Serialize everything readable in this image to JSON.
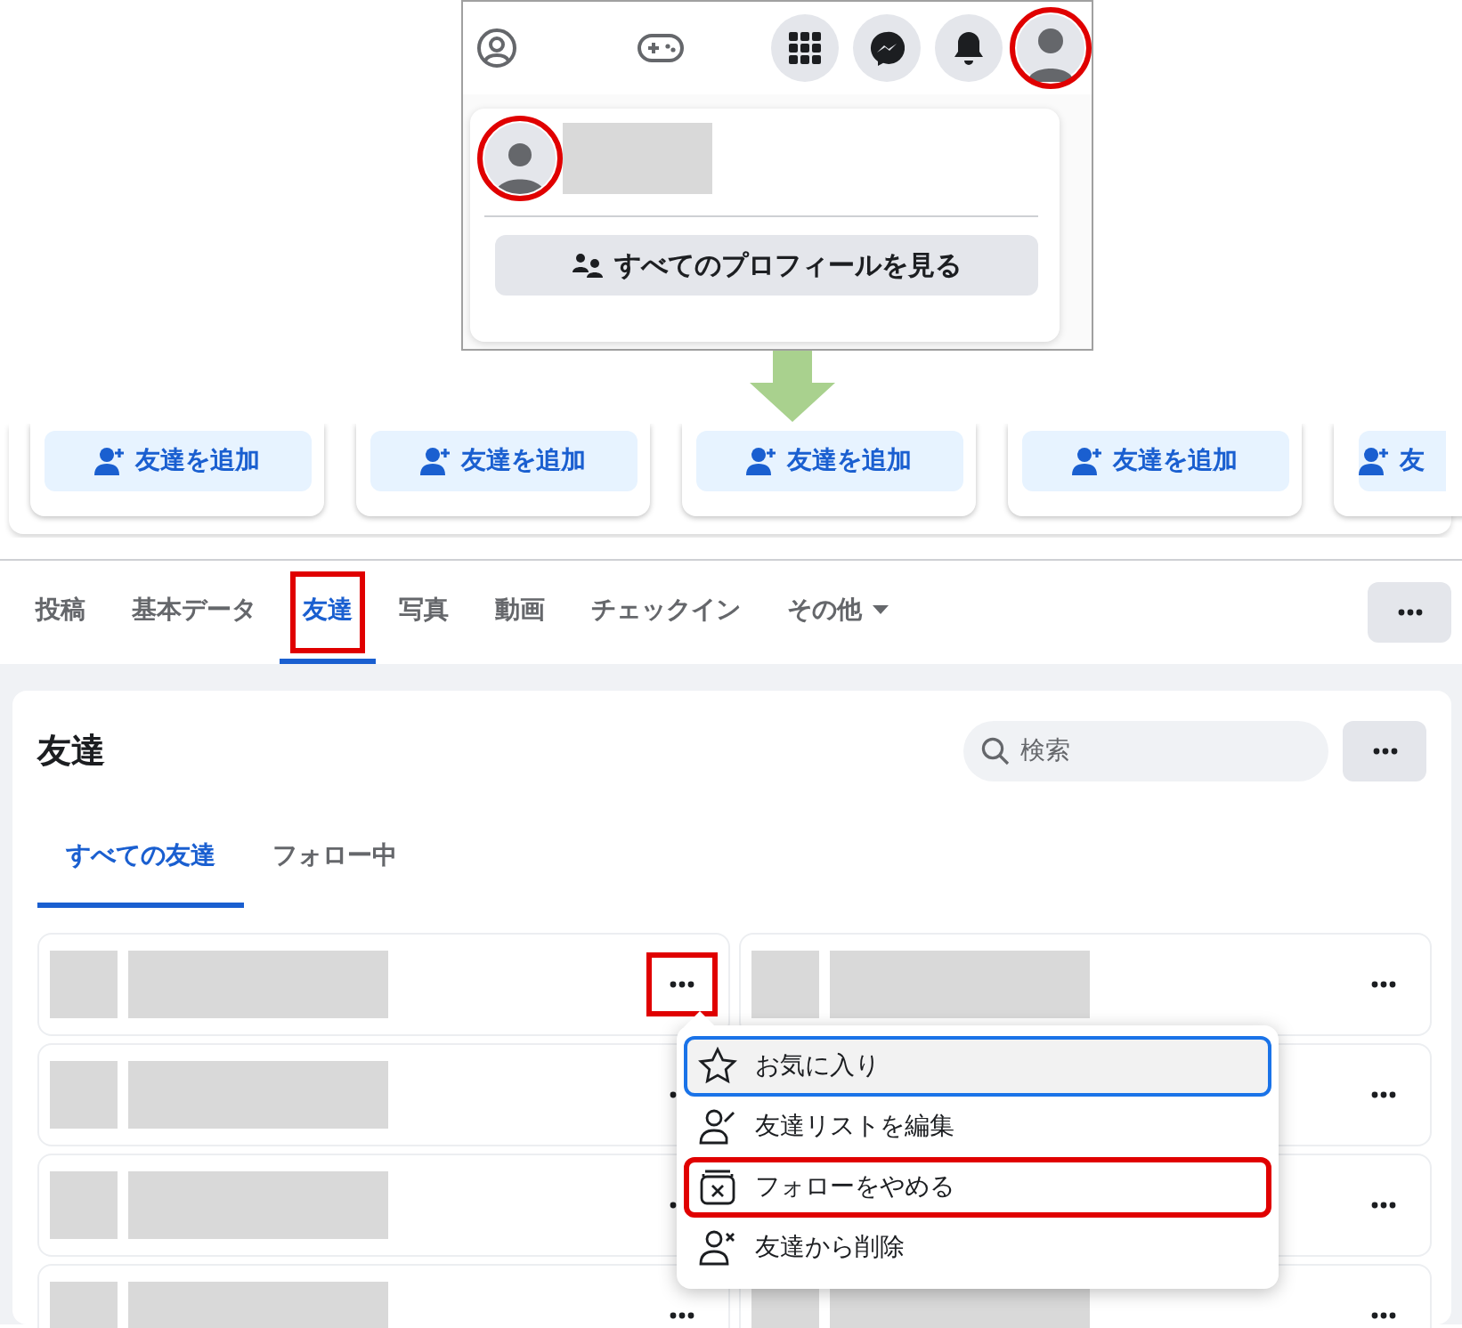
{
  "top_bar": {
    "buttons": [
      {
        "kind": "profiles",
        "highlighted": false
      },
      {
        "kind": "gaming",
        "highlighted": false
      },
      {
        "kind": "menu",
        "highlighted": false
      },
      {
        "kind": "messenger",
        "highlighted": false
      },
      {
        "kind": "notifications",
        "highlighted": false
      },
      {
        "kind": "account",
        "highlighted": true
      }
    ]
  },
  "account_menu": {
    "avatar_highlighted": true,
    "button": "すべてのプロフィールを見る"
  },
  "suggestions": [
    {
      "button": "友達を追加"
    },
    {
      "button": "友達を追加"
    },
    {
      "button": "友達を追加"
    },
    {
      "button": "友達を追加"
    },
    {
      "button": "友"
    }
  ],
  "profile_tabs": [
    {
      "kind": "tab",
      "label": "投稿",
      "selected": false,
      "highlighted": false
    },
    {
      "kind": "tab",
      "label": "基本データ",
      "selected": false,
      "highlighted": false
    },
    {
      "kind": "tab",
      "label": "友達",
      "selected": true,
      "highlighted": true
    },
    {
      "kind": "tab",
      "label": "写真",
      "selected": false,
      "highlighted": false
    },
    {
      "kind": "tab",
      "label": "動画",
      "selected": false,
      "highlighted": false
    },
    {
      "kind": "tab",
      "label": "チェックイン",
      "selected": false,
      "highlighted": false
    },
    {
      "kind": "dropdown",
      "label": "その他",
      "selected": false,
      "highlighted": false
    }
  ],
  "friends": {
    "title": "友達",
    "search": {
      "placeholder": "検索"
    },
    "tabs": [
      {
        "label": "すべての友達",
        "selected": true
      },
      {
        "label": "フォロー中",
        "selected": false
      }
    ],
    "rows": [
      {
        "kind": "full",
        "more_highlighted": true
      },
      {
        "kind": "full",
        "more_highlighted": false
      },
      {
        "kind": "full",
        "more_highlighted": false
      },
      {
        "kind": "covered",
        "more_highlighted": false
      },
      {
        "kind": "full",
        "more_highlighted": false
      },
      {
        "kind": "covered",
        "more_highlighted": false
      },
      {
        "kind": "full",
        "more_highlighted": false
      },
      {
        "kind": "full",
        "more_highlighted": false
      }
    ]
  },
  "context_menu": {
    "items": [
      {
        "kind": "favorite",
        "label": "お気に入り",
        "focused": true,
        "highlighted": false
      },
      {
        "kind": "edit-list",
        "label": "友達リストを編集",
        "focused": false,
        "highlighted": false
      },
      {
        "kind": "unfollow",
        "label": "フォローをやめる",
        "focused": false,
        "highlighted": true
      },
      {
        "kind": "unfriend",
        "label": "友達から削除",
        "focused": false,
        "highlighted": false
      }
    ]
  }
}
